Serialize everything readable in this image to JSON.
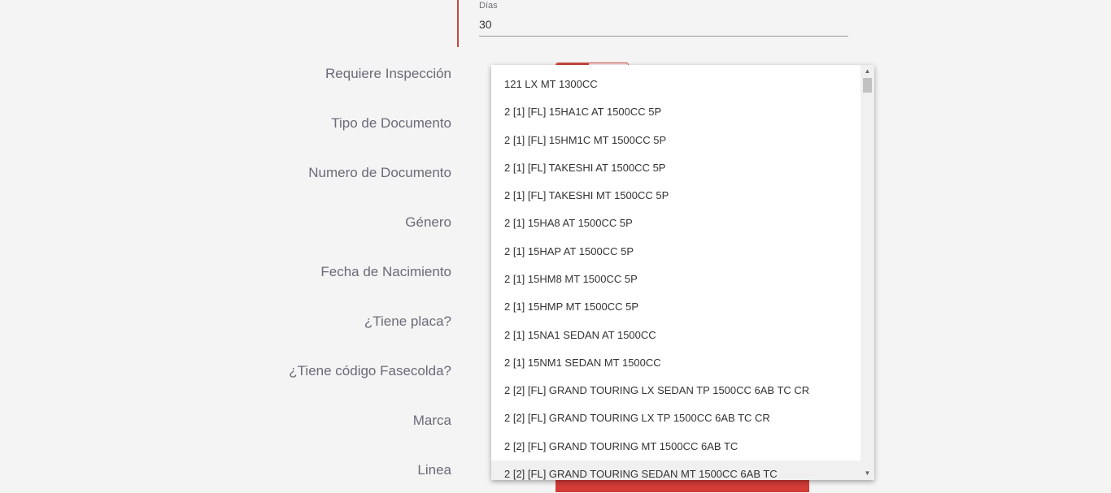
{
  "dias": {
    "label": "Días",
    "value": "30"
  },
  "form_labels": [
    "Requiere Inspección",
    "Tipo de Documento",
    "Numero de Documento",
    "Género",
    "Fecha de Nacimiento",
    "¿Tiene placa?",
    "¿Tiene código Fasecolda?",
    "Marca",
    "Linea"
  ],
  "dropdown": {
    "options": [
      "121 LX MT 1300CC",
      "2 [1] [FL] 15HA1C AT 1500CC 5P",
      "2 [1] [FL] 15HM1C MT 1500CC 5P",
      "2 [1] [FL] TAKESHI AT 1500CC 5P",
      "2 [1] [FL] TAKESHI MT 1500CC 5P",
      "2 [1] 15HA8 AT 1500CC 5P",
      "2 [1] 15HAP AT 1500CC 5P",
      "2 [1] 15HM8 MT 1500CC 5P",
      "2 [1] 15HMP MT 1500CC 5P",
      "2 [1] 15NA1 SEDAN AT 1500CC",
      "2 [1] 15NM1 SEDAN MT 1500CC",
      "2 [2] [FL] GRAND TOURING LX SEDAN TP 1500CC 6AB TC CR",
      "2 [2] [FL] GRAND TOURING LX TP 1500CC 6AB TC CR",
      "2 [2] [FL] GRAND TOURING MT 1500CC 6AB TC",
      "2 [2] [FL] GRAND TOURING SEDAN MT 1500CC 6AB TC"
    ],
    "highlighted_index": 14
  },
  "icons": {
    "scroll_up": "scroll-up-arrow-icon",
    "scroll_down": "scroll-down-arrow-icon"
  },
  "colors": {
    "accent": "#c9473f",
    "label": "#6b6a78"
  }
}
